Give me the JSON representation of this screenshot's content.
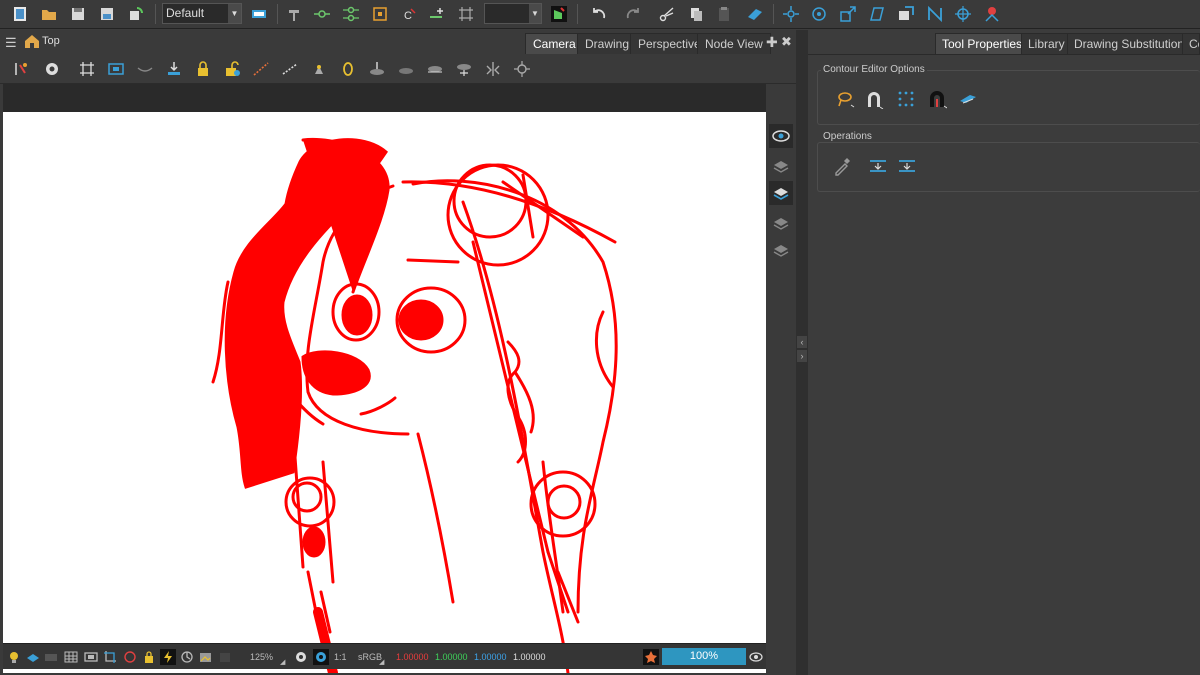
{
  "toolbar": {
    "preset_value": "Default",
    "icons": [
      "new-scene-icon",
      "open-scene-icon",
      "save-icon",
      "save-as-icon",
      "refresh-icon",
      "workspace-icon",
      "hammer-icon",
      "onion-skin-icon",
      "pegs-icon",
      "bounding-box-icon",
      "copy-icon",
      "add-keyframe-icon",
      "grid-icon",
      "paint-bucket-icon",
      "undo-icon",
      "redo-icon",
      "cut-icon",
      "copy-doc-icon",
      "paste-icon",
      "eraser-icon",
      "transform-icon",
      "rotate-icon",
      "scale-icon",
      "skew-icon",
      "maximize-icon",
      "ik-icon",
      "joint-icon",
      "pin-icon"
    ]
  },
  "left_panel": {
    "crumb": "Top",
    "tabs": [
      "Camera",
      "Drawing",
      "Perspective",
      "Node View"
    ],
    "active_tab": "Camera"
  },
  "view_tools": {
    "icons": [
      "transform-tool-icon",
      "settings-gear-icon",
      "grid-toggle-icon",
      "safe-area-icon",
      "mask-icon",
      "import-icon",
      "lock-icon",
      "unlock-icon",
      "light-table-icon",
      "light-table-2-icon",
      "onion-icon",
      "lightbulb-icon",
      "reset-icon",
      "zoom-icon",
      "pan-icon",
      "rotate-view-icon",
      "flip-icon",
      "auto-light-icon"
    ]
  },
  "statusbar": {
    "zoom_text": "125%",
    "ratio": "1:1",
    "color_space": "sRGB",
    "red": "1.00000",
    "green": "1.00000",
    "blue": "1.00000",
    "alpha": "1.00000",
    "zoom_percent": "100%",
    "colors": {
      "red": "#e83c3c",
      "green": "#3ed05a",
      "blue": "#3da2e8",
      "alpha": "#dddddd"
    }
  },
  "right_panel": {
    "tabs": [
      "Tool Properties",
      "Library",
      "Drawing Substitutions",
      "Co"
    ],
    "active_tab": "Tool Properties",
    "contour_label": "Contour Editor Options",
    "operations_label": "Operations"
  },
  "colors": {
    "drawing": "#ff0000",
    "accent": "#2e96c0"
  }
}
